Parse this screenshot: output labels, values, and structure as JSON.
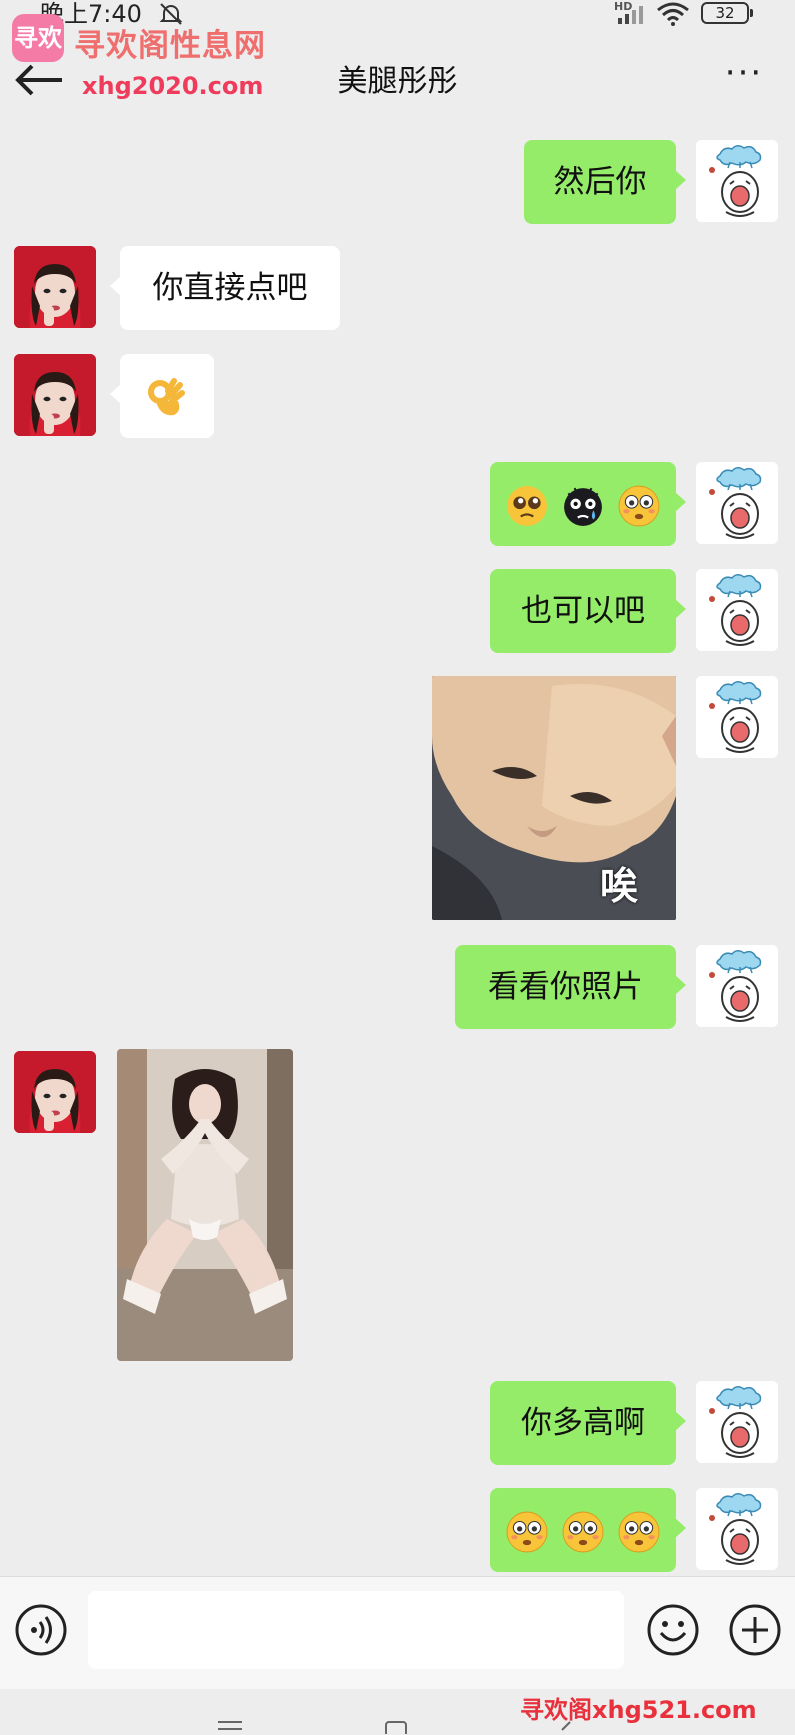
{
  "status_bar": {
    "time": "晚上7:40",
    "network_badge": "HD",
    "battery": "32",
    "icons": [
      "mute-bell-icon",
      "signal-icon",
      "wifi-icon",
      "battery-icon"
    ]
  },
  "watermark": {
    "logo_text": "寻欢",
    "brand": "寻欢阁性息网",
    "domain": "xhg2020.com",
    "bottom": "寻欢阁xhg521.com"
  },
  "header": {
    "title": "美腿彤彤",
    "back_icon": "back-arrow-icon",
    "more_label": "···"
  },
  "messages": [
    {
      "from": "me",
      "type": "text",
      "text": "然后你"
    },
    {
      "from": "her",
      "type": "text",
      "text": "你直接点吧"
    },
    {
      "from": "her",
      "type": "emoji",
      "emojis": [
        "ok-hand-emoji"
      ]
    },
    {
      "from": "me",
      "type": "emoji",
      "emojis": [
        "pleading-face-emoji",
        "black-crying-face-emoji",
        "flushed-face-emoji"
      ]
    },
    {
      "from": "me",
      "type": "text",
      "text": "也可以吧"
    },
    {
      "from": "me",
      "type": "sticker",
      "caption": "唉",
      "icon": "sad-cat-sticker"
    },
    {
      "from": "me",
      "type": "text",
      "text": "看看你照片"
    },
    {
      "from": "her",
      "type": "image",
      "icon": "woman-photo"
    },
    {
      "from": "me",
      "type": "text",
      "text": "你多高啊"
    },
    {
      "from": "me",
      "type": "emoji",
      "emojis": [
        "flushed-face-emoji",
        "flushed-face-emoji",
        "flushed-face-emoji"
      ]
    }
  ],
  "input_bar": {
    "placeholder": "",
    "value": "",
    "icons": [
      "voice-icon",
      "emoji-icon",
      "plus-icon"
    ]
  },
  "colors": {
    "background": "#ededed",
    "my_bubble": "#95ec69",
    "her_bubble": "#ffffff",
    "watermark_red": "#ef3b5c"
  }
}
